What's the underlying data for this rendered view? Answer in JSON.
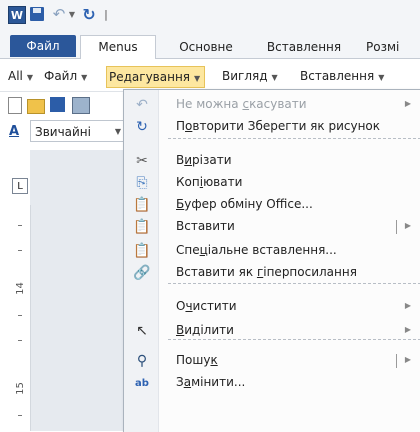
{
  "qat": {
    "word_logo": "W",
    "separator": "|",
    "icons": [
      "word-logo-icon",
      "save-icon",
      "undo-icon",
      "dropdown-arrow-icon",
      "redo-icon",
      "customize-qat-icon"
    ]
  },
  "ribbon_tabs": {
    "file": "Файл",
    "menus": "Menus",
    "home": "Основне",
    "insert": "Вставлення",
    "layout": "Розмі"
  },
  "menus_bar": {
    "all": "All",
    "file": "Файл",
    "edit": "Редагування",
    "view": "Вигляд",
    "insert": "Вставлення",
    "caret": "▼"
  },
  "toolbar": {
    "style_value": "Звичайні",
    "font_icon_glyph": "A"
  },
  "ruler": {
    "corner": "L",
    "labels": [
      "14",
      "15"
    ]
  },
  "edit_menu": {
    "items": [
      {
        "label_parts": [
          "Не можна ",
          "с",
          "касувати"
        ],
        "icon": "undo-icon",
        "glyph": "↶",
        "disabled": true,
        "submenu": true
      },
      {
        "label_parts": [
          "П",
          "о",
          "вторити Зберегти як рисунок"
        ],
        "icon": "redo-icon",
        "glyph": "↻",
        "disabled": false
      },
      {
        "label_parts": [
          "В",
          "и",
          "різати"
        ],
        "icon": "cut-icon",
        "glyph": "✂",
        "disabled": false
      },
      {
        "label_parts": [
          "Коп",
          "і",
          "ювати"
        ],
        "icon": "copy-icon",
        "glyph": "⎘",
        "disabled": false
      },
      {
        "label_parts": [
          "",
          "Б",
          "уфер обміну Office..."
        ],
        "icon": "clipboard-icon",
        "glyph": "📋",
        "disabled": false
      },
      {
        "label_parts": [
          "Вставити",
          "",
          ""
        ],
        "icon": "paste-icon",
        "glyph": "📋",
        "disabled": false,
        "split": true
      },
      {
        "label_parts": [
          "Спе",
          "ц",
          "іальне вставлення..."
        ],
        "icon": "paste-special-icon",
        "glyph": "📋",
        "disabled": false
      },
      {
        "label_parts": [
          "Вставити як ",
          "г",
          "іперпосилання"
        ],
        "icon": "paste-hyperlink-icon",
        "glyph": "🔗",
        "disabled": false
      },
      {
        "label_parts": [
          "О",
          "ч",
          "истити"
        ],
        "icon": "clear-icon",
        "glyph": "",
        "disabled": false,
        "submenu": true
      },
      {
        "label_parts": [
          "",
          "В",
          "иділити"
        ],
        "icon": "select-cursor-icon",
        "glyph": "↖",
        "disabled": false,
        "submenu": true
      },
      {
        "label_parts": [
          "Пошу",
          "к",
          ""
        ],
        "icon": "find-binoculars-icon",
        "glyph": "⚲",
        "disabled": false,
        "split": true
      },
      {
        "label_parts": [
          "З",
          "а",
          "мінити..."
        ],
        "icon": "replace-icon",
        "glyph": "ab",
        "disabled": false
      }
    ],
    "submenu_arrow": "▶"
  },
  "colors": {
    "file_tab": "#2b579a",
    "active_menu": "#fde7a0"
  }
}
